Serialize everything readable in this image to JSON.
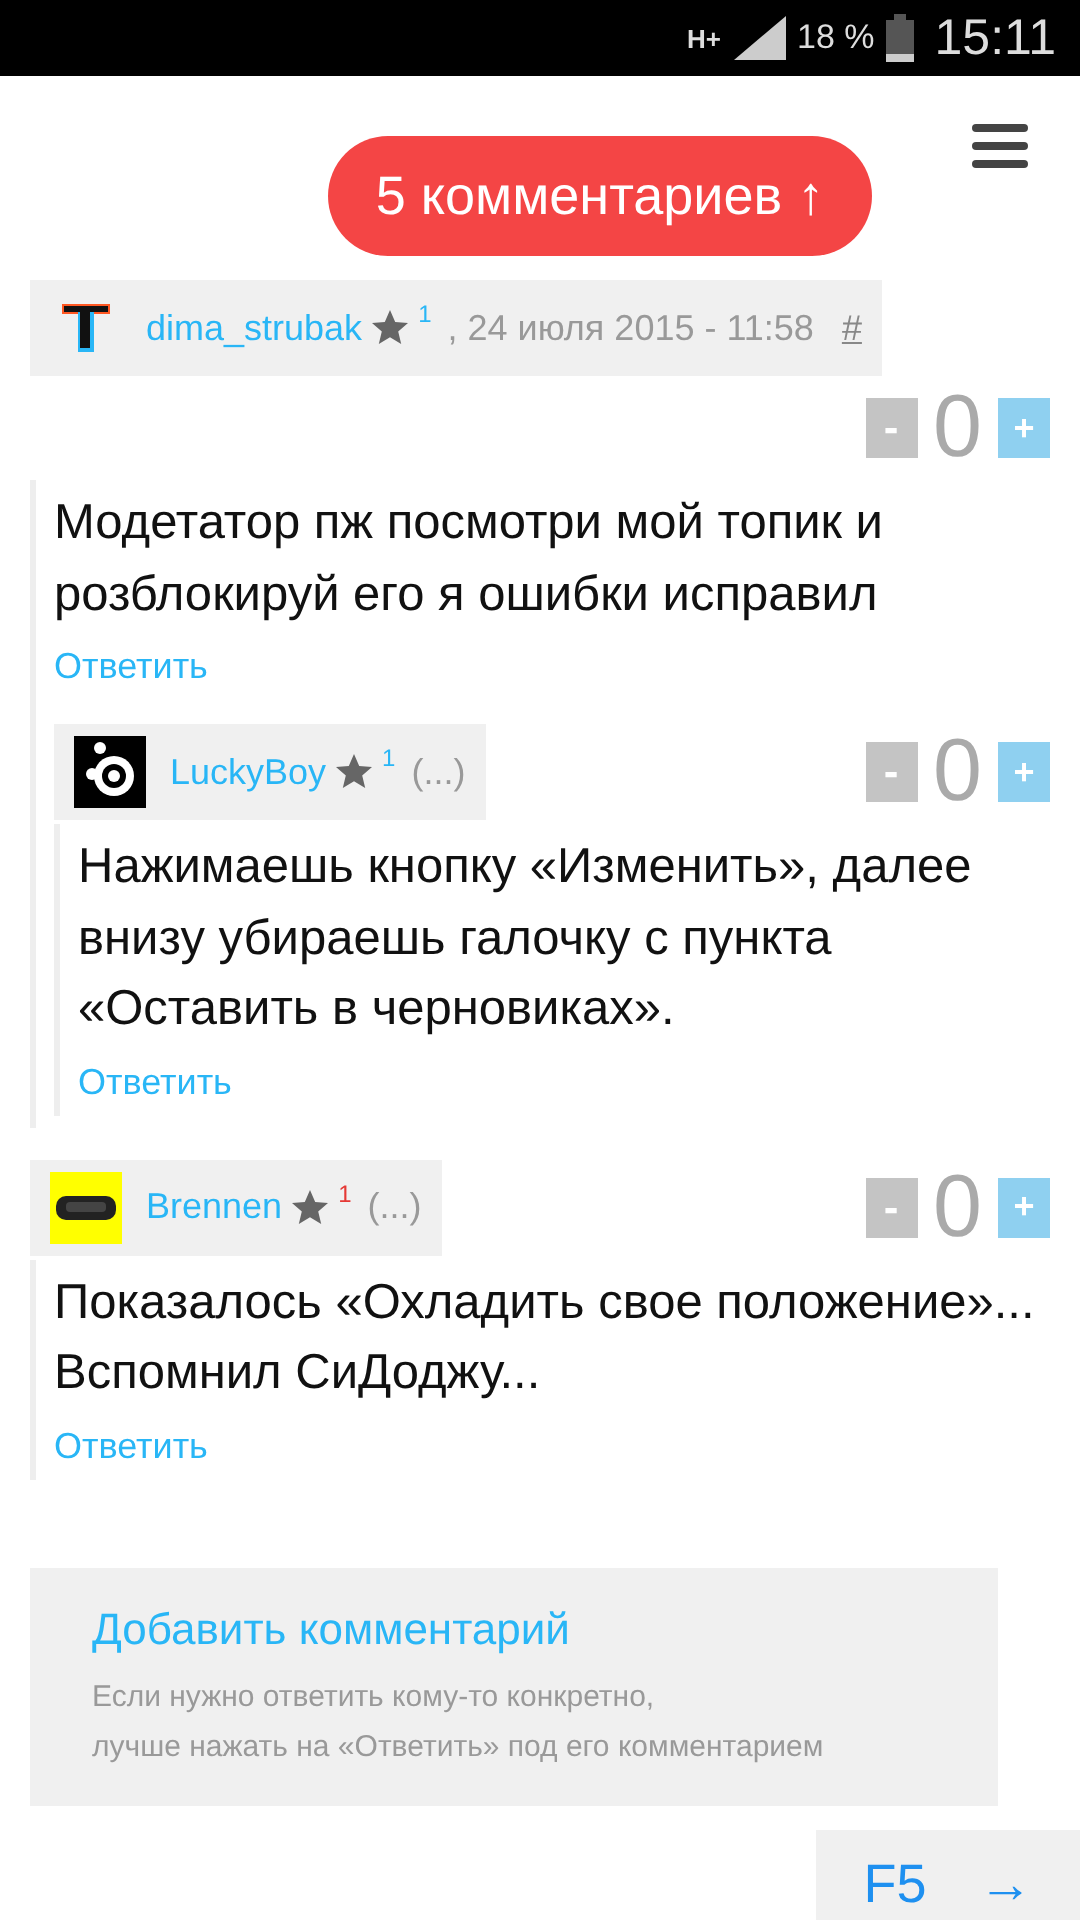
{
  "status_bar": {
    "network": "H+",
    "battery": "18 %",
    "time": "15:11"
  },
  "header": {
    "comments_button": "5 комментариев ↑"
  },
  "vote_labels": {
    "down": "-",
    "up": "+"
  },
  "comments": [
    {
      "author": "dima_strubak",
      "karma": {
        "text": "1",
        "color": "#29b6f6"
      },
      "meta": ", 24 июля 2015 - 11:58",
      "anchor": "#",
      "score": "0",
      "text": "Модетатор пж посмотри мой топик и розблокируй его я ошибки исправил",
      "reply": "Ответить",
      "children": [
        {
          "author": "LuckyBoy",
          "karma": {
            "text": "1",
            "color": "#29b6f6"
          },
          "meta": "(...)",
          "score": "0",
          "text": "Нажимаешь кнопку «Изменить», далее внизу убираешь галочку с пункта «Оставить в черновиках».",
          "reply": "Ответить"
        }
      ]
    },
    {
      "author": "Brennen",
      "karma": {
        "text": "1",
        "color": "#e53935"
      },
      "meta": "(...)",
      "score": "0",
      "text": "Показалось «Охладить свое положение»... Вспомнил СиДоджу...",
      "reply": "Ответить"
    }
  ],
  "add_comment": {
    "title": "Добавить комментарий",
    "hint_lines": [
      "Если нужно ответить кому-то конкретно,",
      "лучше нажать на «Ответить» под его комментарием"
    ]
  },
  "refresh_button": {
    "label": "F5",
    "arrow": "→"
  }
}
